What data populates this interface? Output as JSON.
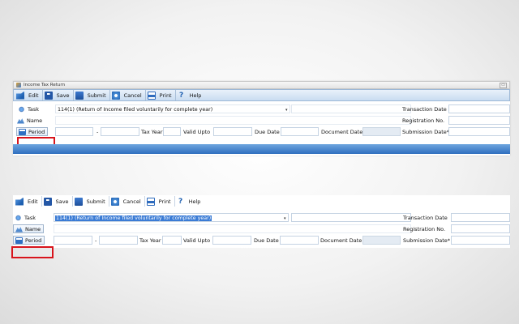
{
  "window": {
    "title": "Income Tax Return",
    "control_glyph": "▭"
  },
  "toolbar": {
    "buttons": [
      {
        "label": "Edit",
        "icon": "edit-icon"
      },
      {
        "label": "Save",
        "icon": "save-icon"
      },
      {
        "label": "Submit",
        "icon": "submit-icon"
      },
      {
        "label": "Cancel",
        "icon": "cancel-icon"
      },
      {
        "label": "Print",
        "icon": "print-icon"
      },
      {
        "label": "Help",
        "icon": "help-icon"
      }
    ],
    "help_glyph": "?"
  },
  "form": {
    "task_label": "Task",
    "task_value": "114(1) (Return of Income filed voluntarily for complete year)",
    "dropdown_glyph": "▾",
    "name_label": "Name",
    "period_label": "Period",
    "period_separator": "-",
    "tax_year_label": "Tax Year",
    "valid_upto_label": "Valid Upto",
    "due_date_label": "Due Date",
    "document_date_label": "Document Date",
    "transaction_date_label": "Transaction Date",
    "registration_no_label": "Registration No.",
    "submission_date_label": "Submission Date*"
  },
  "highlights": {
    "top_panel": "Name",
    "bottom_panel": "Period",
    "color": "#d8141c"
  },
  "colors": {
    "toolbar_gradient_top": "#e9f1fa",
    "accent_blue": "#2f6fbf",
    "selection": "#3a7bd5"
  }
}
